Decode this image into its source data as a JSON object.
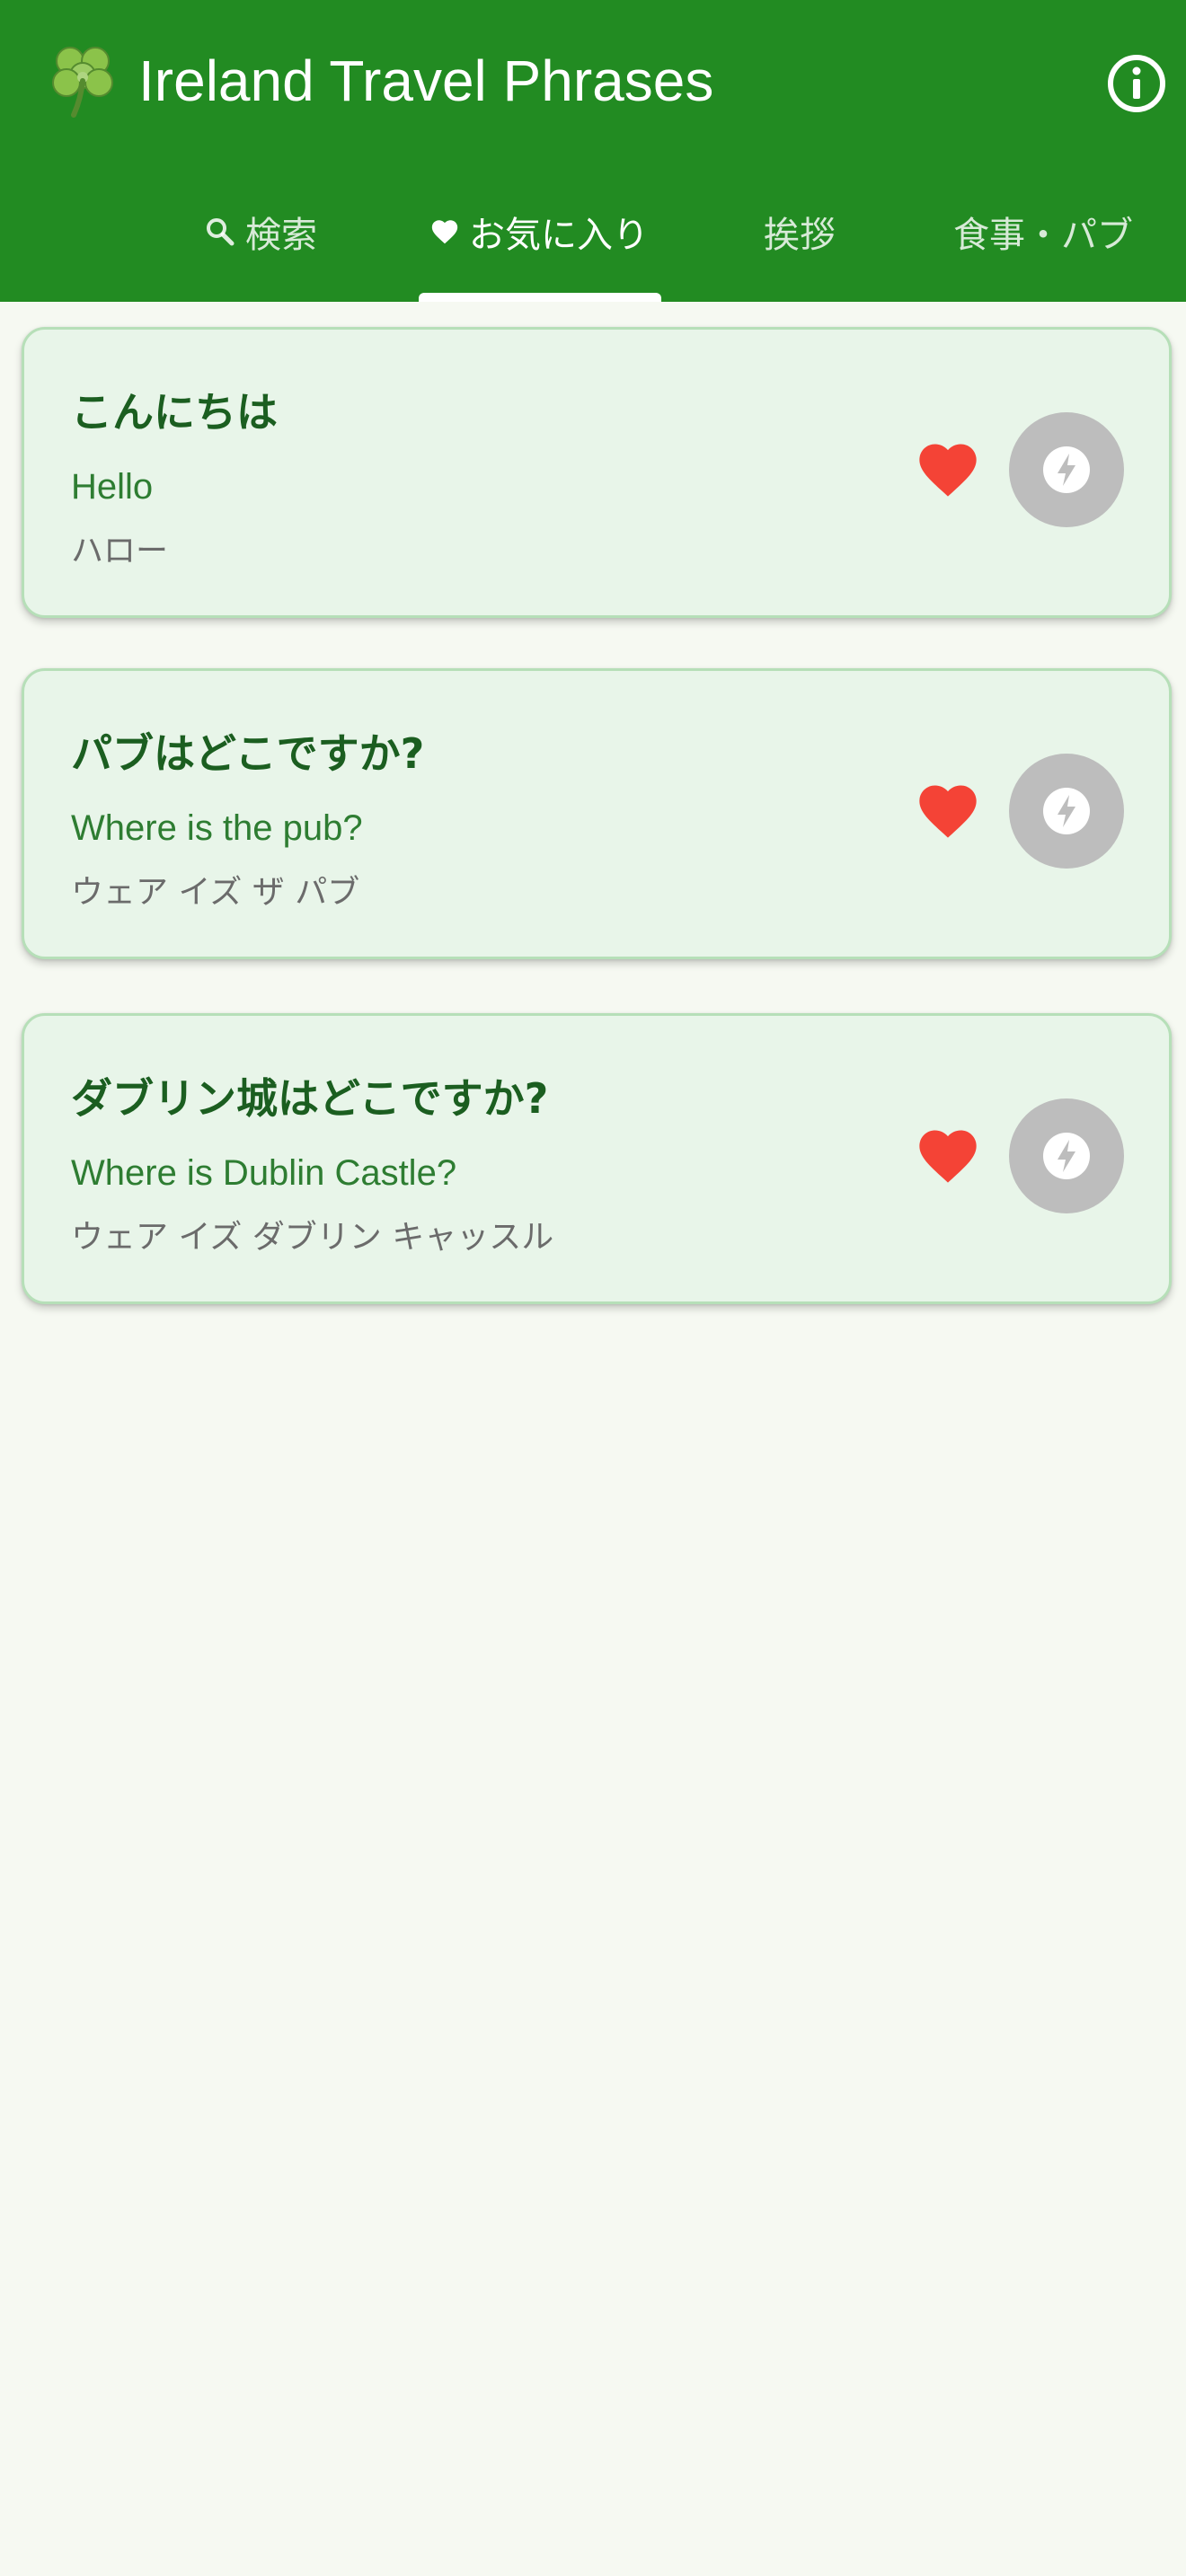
{
  "app": {
    "title": "Ireland Travel Phrases",
    "icon": "shamrock-icon"
  },
  "header": {
    "info_icon": "info-icon"
  },
  "tabs": [
    {
      "label": "検索",
      "icon": "search-icon",
      "active": false
    },
    {
      "label": "お気に入り",
      "icon": "heart-icon",
      "active": true
    },
    {
      "label": "挨拶",
      "active": false
    },
    {
      "label": "食事・パブ",
      "active": false
    }
  ],
  "phrases": [
    {
      "japanese": "こんにちは",
      "english": "Hello",
      "katakana": "ハロー",
      "favorite": true
    },
    {
      "japanese": "パブはどこですか?",
      "english": "Where is the pub?",
      "katakana": "ウェア イズ ザ パブ",
      "favorite": true
    },
    {
      "japanese": "ダブリン城はどこですか?",
      "english": "Where is Dublin Castle?",
      "katakana": "ウェア イズ ダブリン キャッスル",
      "favorite": true
    }
  ],
  "colors": {
    "primary": "#228b22",
    "background": "#f6f9f2",
    "card_background": "#e8f5e9",
    "card_border": "#b6dfb8",
    "heart": "#f44336",
    "play_button": "#bdbdbd"
  }
}
